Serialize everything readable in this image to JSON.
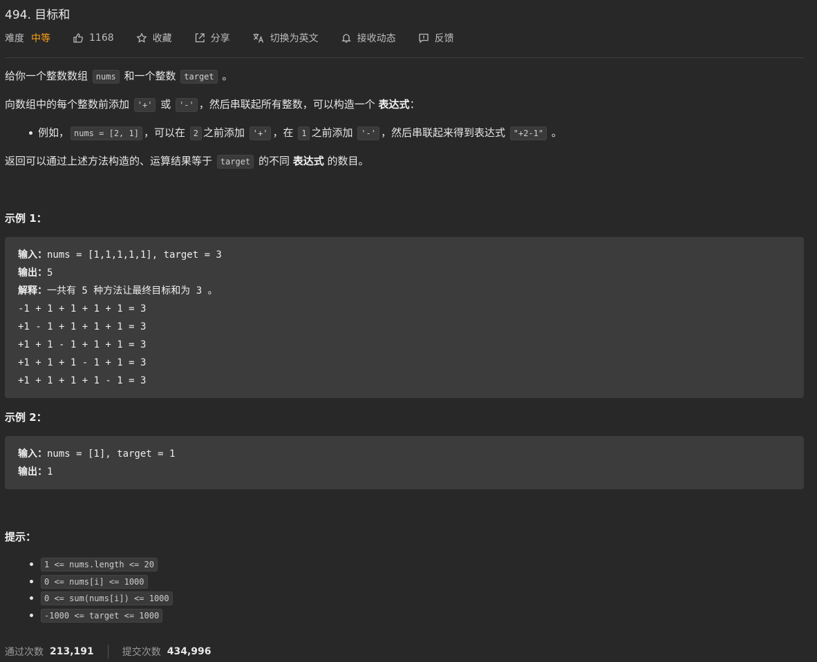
{
  "problem": {
    "title": "494. 目标和",
    "difficulty_label": "难度",
    "difficulty_value": "中等",
    "likes": "1168",
    "favorite_label": "收藏",
    "share_label": "分享",
    "switch_lang_label": "切换为英文",
    "subscribe_label": "接收动态",
    "feedback_label": "反馈"
  },
  "description": {
    "p1_a": "给你一个整数数组",
    "p1_code1": "nums",
    "p1_b": "和一个整数",
    "p1_code2": "target",
    "p1_c": "。",
    "p2_a": "向数组中的每个整数前添加",
    "p2_code1": "'+'",
    "p2_b": "或",
    "p2_code2": "'-'",
    "p2_c": "，然后串联起所有整数，可以构造一个",
    "p2_bold": "表达式",
    "p2_d": "：",
    "li_a": "例如，",
    "li_code1": "nums = [2, 1]",
    "li_b": "，可以在",
    "li_code2": "2",
    "li_c": "之前添加",
    "li_code3": "'+'",
    "li_d": "，在",
    "li_code4": "1",
    "li_e": "之前添加",
    "li_code5": "'-'",
    "li_f": "，然后串联起来得到表达式",
    "li_code6": "\"+2-1\"",
    "li_g": "。",
    "p3_a": "返回可以通过上述方法构造的、运算结果等于",
    "p3_code": "target",
    "p3_b": "的不同",
    "p3_bold": "表达式",
    "p3_c": "的数目。"
  },
  "example1": {
    "title": "示例 1：",
    "input_label": "输入：",
    "input_value": "nums = [1,1,1,1,1], target = 3",
    "output_label": "输出：",
    "output_value": "5",
    "explain_label": "解释：",
    "explain_value": "一共有 5 种方法让最终目标和为 3 。",
    "lines": [
      "-1 + 1 + 1 + 1 + 1 = 3",
      "+1 - 1 + 1 + 1 + 1 = 3",
      "+1 + 1 - 1 + 1 + 1 = 3",
      "+1 + 1 + 1 - 1 + 1 = 3",
      "+1 + 1 + 1 + 1 - 1 = 3"
    ]
  },
  "example2": {
    "title": "示例 2：",
    "input_label": "输入：",
    "input_value": "nums = [1], target = 1",
    "output_label": "输出：",
    "output_value": "1"
  },
  "hints": {
    "title": "提示：",
    "items": [
      "1 <= nums.length <= 20",
      "0 <= nums[i] <= 1000",
      "0 <= sum(nums[i]) <= 1000",
      "-1000 <= target <= 1000"
    ]
  },
  "stats": {
    "accepted_label": "通过次数",
    "accepted_value": "213,191",
    "submissions_label": "提交次数",
    "submissions_value": "434,996"
  },
  "colors": {
    "background": "#282828",
    "difficulty_medium": "#ffa116",
    "code_block_bg": "#3c3c3c"
  }
}
